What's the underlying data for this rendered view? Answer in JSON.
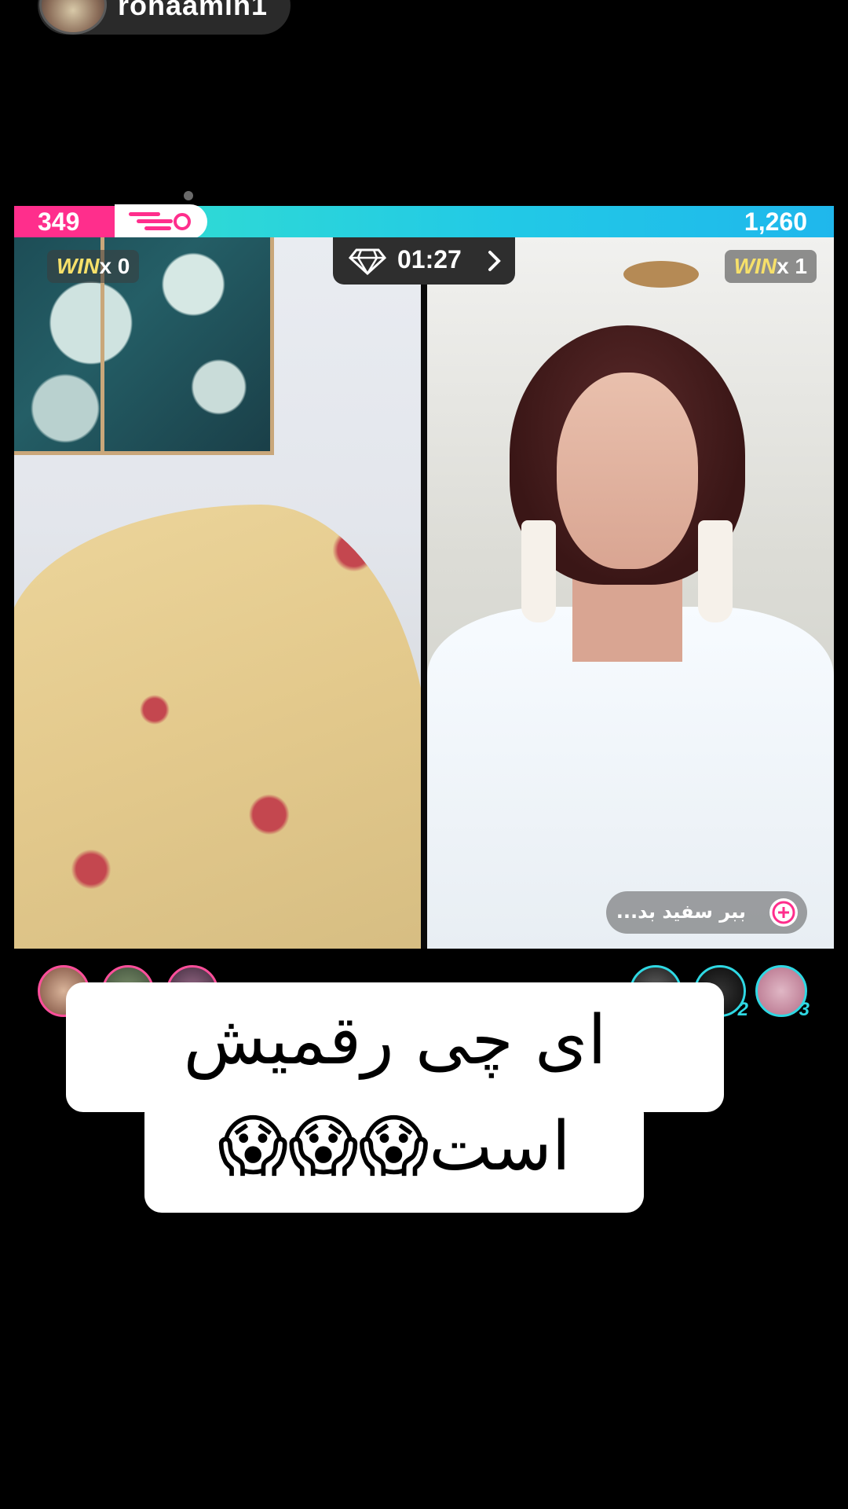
{
  "host": {
    "name": "rohaamin1"
  },
  "battle": {
    "score_left": "349",
    "score_right": "1,260",
    "timer": "01:27",
    "left_win": {
      "word": "WIN",
      "count": "x 0"
    },
    "right_win": {
      "word": "WIN",
      "count": "x 1"
    }
  },
  "follow_chip": {
    "text": "ببر سفید بد..."
  },
  "gifters": {
    "right_ranks": [
      "2",
      "3"
    ]
  },
  "caption": {
    "line1": "ای چی رقمیش",
    "line2": "است😱😱😱"
  },
  "colors": {
    "left_team": "#ff2e8c",
    "right_team": "#22c9e6",
    "win_word": "#f6e06a"
  }
}
